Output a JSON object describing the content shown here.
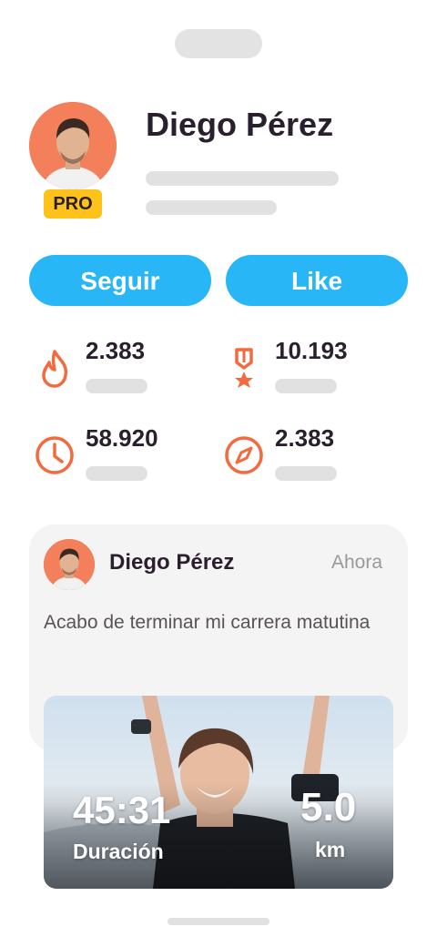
{
  "profile": {
    "name": "Diego Pérez",
    "badge": "PRO"
  },
  "actions": {
    "follow_label": "Seguir",
    "like_label": "Like"
  },
  "stats": [
    {
      "icon": "flame-icon",
      "value": "2.383"
    },
    {
      "icon": "medal-icon",
      "value": "10.193"
    },
    {
      "icon": "clock-icon",
      "value": "58.920"
    },
    {
      "icon": "compass-icon",
      "value": "2.383"
    }
  ],
  "post": {
    "author": "Diego Pérez",
    "time": "Ahora",
    "text": "Acabo de terminar mi carrera matutina",
    "duration_value": "45:31",
    "duration_label": "Duración",
    "distance_value": "5.0",
    "distance_unit": "km"
  },
  "colors": {
    "accent": "#29b6f6",
    "icon": "#f26a3d",
    "badge": "#ffc21a",
    "avatar_bg": "#f37f5b"
  }
}
